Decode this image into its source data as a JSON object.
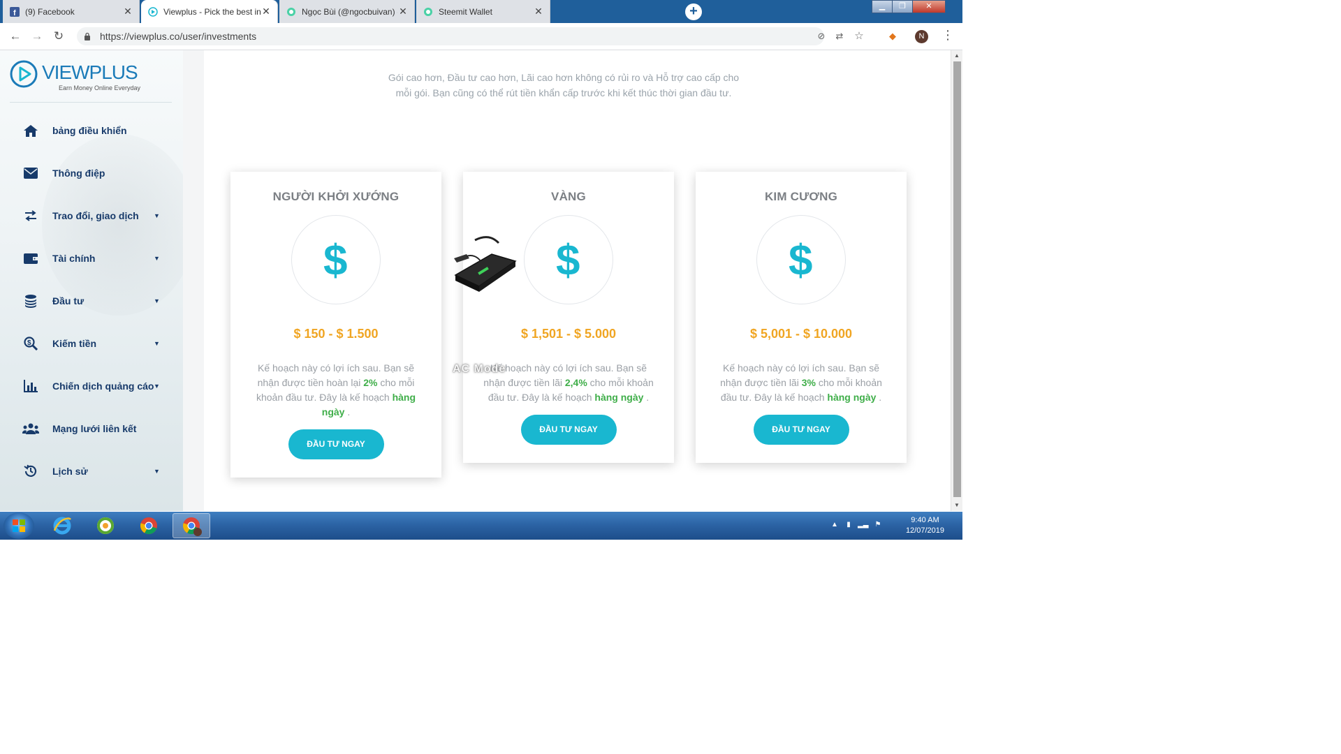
{
  "browser": {
    "tabs": [
      {
        "title": "(9) Facebook",
        "icon": "facebook-icon"
      },
      {
        "title": "Viewplus - Pick the best invest pl",
        "icon": "viewplus-icon"
      },
      {
        "title": "Ngọc Bùi (@ngocbuivan) — Stee",
        "icon": "steemit-icon"
      },
      {
        "title": "Steemit Wallet",
        "icon": "steemit-icon"
      }
    ],
    "new_tab_label": "+",
    "url": "https://viewplus.co/user/investments",
    "profile_initial": "N",
    "window_buttons": {
      "minimize": "▁",
      "maximize": "❐",
      "close": "✕"
    }
  },
  "sidebar": {
    "logo": {
      "word": "VIEWPLUS",
      "tagline": "Earn Money Online Everyday"
    },
    "items": [
      {
        "label": "bảng điều khiển",
        "icon": "home-icon",
        "has_caret": false
      },
      {
        "label": "Thông điệp",
        "icon": "envelope-icon",
        "has_caret": false
      },
      {
        "label": "Trao đổi, giao dịch",
        "icon": "exchange-icon",
        "has_caret": true
      },
      {
        "label": "Tài chính",
        "icon": "wallet-icon",
        "has_caret": true
      },
      {
        "label": "Đầu tư",
        "icon": "coins-icon",
        "has_caret": true
      },
      {
        "label": "Kiếm tiền",
        "icon": "search-dollar-icon",
        "has_caret": true
      },
      {
        "label": "Chiến dịch quảng cáo",
        "icon": "bar-chart-icon",
        "has_caret": true
      },
      {
        "label": "Mạng lưới liên kết",
        "icon": "users-icon",
        "has_caret": false
      },
      {
        "label": "Lịch sử",
        "icon": "history-icon",
        "has_caret": true
      }
    ]
  },
  "main": {
    "intro": "Gói cao hơn, Đầu tư cao hơn, Lãi cao hơn không có rủi ro và Hỗ trợ cao cấp cho mỗi gói. Bạn cũng có thể rút tiền khẩn cấp trước khi kết thúc thời gian đầu tư.",
    "plans": [
      {
        "name": "NGƯỜI KHỞI XƯỚNG",
        "range": "$ 150 - $ 1.500",
        "desc_pre": "Kế hoạch này có lợi ích sau. Bạn sẽ nhận được tiền hoàn lại ",
        "rate": "2%",
        "desc_mid": " cho mỗi khoản đầu tư. Đây là kế hoạch ",
        "freq": "hàng ngày",
        "desc_post": " .",
        "button": "ĐẦU TƯ NGAY"
      },
      {
        "name": "VÀNG",
        "range": "$ 1,501 - $ 5.000",
        "desc_pre": "Kế hoạch này có lợi ích sau. Bạn sẽ nhận được tiền lãi ",
        "rate": "2,4%",
        "desc_mid": " cho mỗi khoản đầu tư. Đây là kế hoạch ",
        "freq": "hàng ngày",
        "desc_post": " .",
        "button": "ĐẦU TƯ NGAY"
      },
      {
        "name": "KIM CƯƠNG",
        "range": "$ 5,001 - $ 10.000",
        "desc_pre": "Kế hoạch này có lợi ích sau. Bạn sẽ nhận được tiền lãi ",
        "rate": "3%",
        "desc_mid": " cho mỗi khoản đầu tư. Đây là kế hoạch ",
        "freq": "hàng ngày",
        "desc_post": " .",
        "button": "ĐẦU TƯ NGAY"
      }
    ],
    "overlay_text": "AC Mode"
  },
  "taskbar": {
    "time": "9:40 AM",
    "date": "12/07/2019",
    "apps": [
      "internet-explorer-icon",
      "coccoc-icon",
      "chrome-icon",
      "chrome-profile-icon"
    ]
  },
  "colors": {
    "accent": "#19b7d0",
    "price": "#f0a522",
    "highlight": "#3fae49",
    "nav_text": "#173a6a",
    "brand": "#1b7bb8"
  }
}
